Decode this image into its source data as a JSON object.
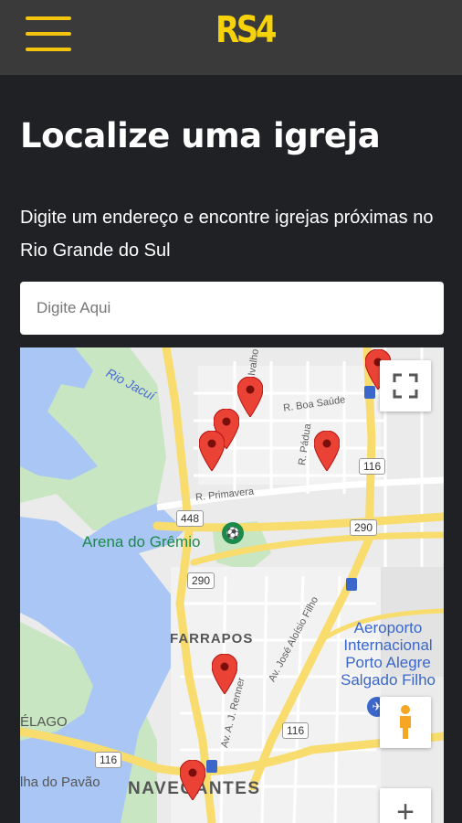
{
  "header": {
    "logo_text": "RS4"
  },
  "page": {
    "title": "Localize uma igreja",
    "subtitle": "Digite um endereço e encontre igrejas próximas no Rio Grande do Sul"
  },
  "search": {
    "placeholder": "Digite Aqui",
    "value": ""
  },
  "map": {
    "labels": {
      "rio_jacui": "Rio Jacuí",
      "arena": "Arena do Grêmio",
      "farrapos": "FARRAPOS",
      "navegantes": "NAVEGANTES",
      "airport": "Aeroporto Internacional Porto Alegre Salgado Filho",
      "airport_line1": "Aeroporto",
      "airport_line2": "Internacional",
      "airport_line3": "Porto Alegre",
      "airport_line4": "Salgado Filho",
      "arquipelago": "ÉLAGO",
      "ilha_pavao": "lha do Pavão",
      "r_primavera": "R. Primavera",
      "r_boa_saude": "R. Boa Saúde",
      "r_padua": "R. Pádua",
      "r_top": "Ivalho Borges",
      "av_reiner": "Av. A. J. Renner",
      "av_jose": "Av. José Aloísio Filho"
    },
    "shields": [
      "448",
      "290",
      "290",
      "116",
      "116",
      "116"
    ],
    "controls": {
      "zoom_in": "+"
    },
    "marker_color": "#ea4335",
    "water_color": "#a9c6f5",
    "park_color": "#c8e6c2",
    "road_color": "#f9dc6e"
  }
}
